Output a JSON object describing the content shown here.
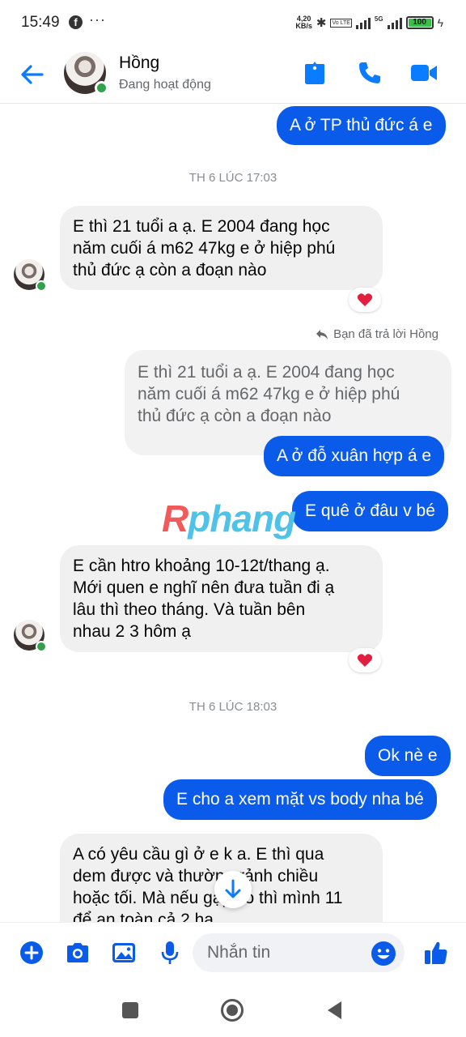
{
  "status_bar": {
    "time": "15:49",
    "dots": "···",
    "speed_value": "4,20",
    "speed_unit": "KB/s",
    "network": "5G",
    "battery": "100",
    "battery_level": 1.0,
    "volte": "Vo LTE"
  },
  "header": {
    "name": "Hồng",
    "status": "Đang hoạt động",
    "accent": "#0a7cff"
  },
  "conversation": {
    "msg1": "A ở TP thủ đức á e",
    "time1": "TH 6 LÚC 17:03",
    "msg2_lines": [
      "E thì 21 tuổi a ạ. E 2004 đang học",
      "năm cuối á m62 47kg  e ở hiệp phú",
      "thủ đức ạ còn a đoạn nào"
    ],
    "replied_note": "Bạn đã trả lời Hồng",
    "quote_lines": [
      "E thì 21 tuổi a ạ. E 2004 đang học",
      "năm cuối á m62 47kg  e ở hiệp phú",
      "thủ đức ạ còn a đoạn nào"
    ],
    "msg3": "A ở đỗ xuân hợp á e",
    "msg4": "E quê ở đâu v bé",
    "watermark_1": "R",
    "watermark_2": "phang",
    "msg5_lines": [
      "E cần htro khoảng 10-12t/thang ạ.",
      "Mới quen e nghĩ nên đưa tuần đi ạ",
      "lâu thì theo tháng.  Và tuần bên",
      "nhau 2 3 hôm ạ"
    ],
    "time2": "TH 6 LÚC 18:03",
    "msg6": "Ok nè e",
    "msg7": "E cho a xem mặt vs body nha bé",
    "msg8_lines": [
      "A có yêu cầu gì ở e k a. E thì qua",
      "dem được và thường rảnh chiều",
      "hoặc tối. Mà nếu gặp có thì mình 11",
      "để an toàn cả 2 ha"
    ],
    "reaction_icon": "heart-icon",
    "bubble_out_color": "#0a5bea",
    "bubble_in_color": "#f0f0f0"
  },
  "composer": {
    "placeholder": "Nhắn tin"
  }
}
